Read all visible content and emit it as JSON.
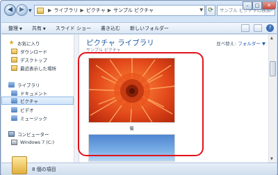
{
  "address": {
    "crumbs": [
      "ライブラリ",
      "ピクチャ",
      "サンプル ピクチャ"
    ],
    "separator": "▶"
  },
  "search": {
    "placeholder": "サンプル ピクチャの検索"
  },
  "toolbar": {
    "organize": "整理",
    "share": "共有",
    "slideshow": "スライド ショー",
    "burn": "書き込む",
    "new_folder": "新しいフォルダー"
  },
  "sidebar": {
    "items": [
      {
        "label": "お気に入り",
        "icon": "star-icon"
      },
      {
        "label": "ダウンロード",
        "icon": "folder-icon"
      },
      {
        "label": "デスクトップ",
        "icon": "folder-icon"
      },
      {
        "label": "最近表示した場所",
        "icon": "folder-icon"
      },
      {
        "label": "ライブラリ",
        "icon": "library-icon"
      },
      {
        "label": "ドキュメント",
        "icon": "library-icon"
      },
      {
        "label": "ピクチャ",
        "icon": "library-icon"
      },
      {
        "label": "ビデオ",
        "icon": "library-icon"
      },
      {
        "label": "ミュージック",
        "icon": "library-icon"
      },
      {
        "label": "コンピューター",
        "icon": "computer-icon"
      },
      {
        "label": "Windows 7 (C:)",
        "icon": "drive-icon"
      }
    ]
  },
  "main": {
    "library_title": "ピクチャ ライブラリ",
    "library_subtitle": "サンプル ピクチャ",
    "arrange_label": "並べ替え:",
    "arrange_value": "フォルダー",
    "photo_caption": "菊"
  },
  "status": {
    "text": "8 個の項目"
  },
  "colors": {
    "highlight": "#e2111a",
    "title": "#1e5ba0",
    "link": "#1f5dbb"
  }
}
